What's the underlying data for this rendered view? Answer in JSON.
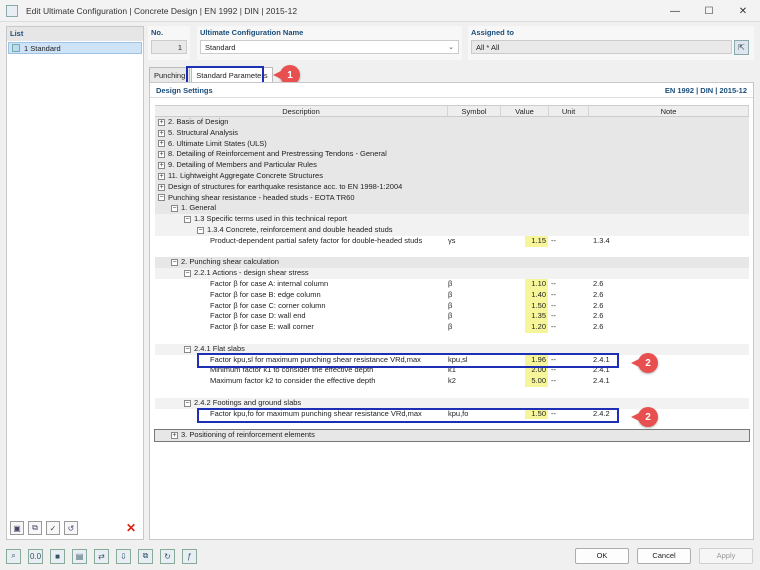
{
  "window": {
    "title": "Edit Ultimate Configuration | Concrete Design | EN 1992 | DIN | 2015-12",
    "min": "—",
    "max": "☐",
    "close": "✕"
  },
  "list": {
    "header": "List",
    "items": [
      {
        "label": "1 Standard"
      }
    ]
  },
  "fields": {
    "no_label": "No.",
    "no_value": "1",
    "name_label": "Ultimate Configuration Name",
    "name_value": "Standard",
    "assigned_label": "Assigned to",
    "assigned_value": "All   *  All"
  },
  "tabs": [
    {
      "label": "Punching",
      "active": false
    },
    {
      "label": "Standard Parameters",
      "active": true
    }
  ],
  "callouts": [
    "1",
    "2",
    "2"
  ],
  "design_settings": {
    "title": "Design Settings",
    "standard": "EN 1992 | DIN | 2015-12"
  },
  "columns": {
    "description": "Description",
    "symbol": "Symbol",
    "value": "Value",
    "unit": "Unit",
    "note": "Note"
  },
  "rows": [
    {
      "id": "r1",
      "desc": "2. Basis of Design",
      "exp": "+"
    },
    {
      "id": "r2",
      "desc": "5. Structural Analysis",
      "exp": "+"
    },
    {
      "id": "r3",
      "desc": "6. Ultimate Limit States (ULS)",
      "exp": "+"
    },
    {
      "id": "r4",
      "desc": "8. Detailing of Reinforcement and Prestressing Tendons - General",
      "exp": "+"
    },
    {
      "id": "r5",
      "desc": "9. Detailing of Members and Particular Rules",
      "exp": "+"
    },
    {
      "id": "r6",
      "desc": "11. Lightweight Aggregate Concrete Structures",
      "exp": "+"
    },
    {
      "id": "r7",
      "desc": "Design of structures for earthquake resistance acc. to EN 1998-1:2004",
      "exp": "+"
    },
    {
      "id": "r8",
      "desc": "Punching shear resistance - headed studs - EOTA TR60",
      "exp": "−"
    },
    {
      "id": "r9",
      "desc": "1. General",
      "exp": "−"
    },
    {
      "id": "r10",
      "desc": "1.3 Specific terms used in this technical report",
      "exp": "−"
    },
    {
      "id": "r11",
      "desc": "1.3.4 Concrete, reinforcement and double headed studs",
      "exp": "−"
    },
    {
      "id": "r12",
      "desc": "Product-dependent partial safety factor for double-headed studs",
      "sym": "γs",
      "val": "1.15",
      "unit": "--",
      "note": "1.3.4"
    },
    {
      "id": "r13",
      "desc": ""
    },
    {
      "id": "r14",
      "desc": "2. Punching shear calculation",
      "exp": "−"
    },
    {
      "id": "r15",
      "desc": "2.2.1 Actions - design shear stress",
      "exp": "−"
    },
    {
      "id": "r16",
      "desc": "Factor β for case A: internal column",
      "sym": "β",
      "val": "1.10",
      "unit": "--",
      "note": "2.6"
    },
    {
      "id": "r17",
      "desc": "Factor β for case B: edge column",
      "sym": "β",
      "val": "1.40",
      "unit": "--",
      "note": "2.6"
    },
    {
      "id": "r18",
      "desc": "Factor β for case C: corner column",
      "sym": "β",
      "val": "1.50",
      "unit": "--",
      "note": "2.6"
    },
    {
      "id": "r19",
      "desc": "Factor β for case D: wall end",
      "sym": "β",
      "val": "1.35",
      "unit": "--",
      "note": "2.6"
    },
    {
      "id": "r20",
      "desc": "Factor β for case E: wall corner",
      "sym": "β",
      "val": "1.20",
      "unit": "--",
      "note": "2.6"
    },
    {
      "id": "r21",
      "desc": ""
    },
    {
      "id": "r22",
      "desc": "2.4.1 Flat slabs",
      "exp": "−"
    },
    {
      "id": "r23",
      "desc": "Factor kpu,sl for maximum punching shear resistance VRd,max",
      "sym": "kpu,sl",
      "val": "1.96",
      "unit": "--",
      "note": "2.4.1"
    },
    {
      "id": "r24",
      "desc": "Minimum factor k1 to consider the effective depth",
      "sym": "k1",
      "val": "2.00",
      "unit": "--",
      "note": "2.4.1"
    },
    {
      "id": "r25",
      "desc": "Maximum factor k2 to consider the effective depth",
      "sym": "k2",
      "val": "5.00",
      "unit": "--",
      "note": "2.4.1"
    },
    {
      "id": "r26",
      "desc": ""
    },
    {
      "id": "r27",
      "desc": "2.4.2 Footings and ground slabs",
      "exp": "−"
    },
    {
      "id": "r28",
      "desc": "Factor kpu,fo for maximum punching shear resistance VRd,max",
      "sym": "kpu,fo",
      "val": "1.50",
      "unit": "--",
      "note": "2.4.2"
    },
    {
      "id": "r29",
      "desc": ""
    },
    {
      "id": "r30",
      "desc": "3. Positioning of reinforcement elements",
      "exp": "+"
    }
  ],
  "buttons": {
    "ok": "OK",
    "cancel": "Cancel",
    "apply": "Apply"
  },
  "colors": {
    "accent": "#1a4d7a",
    "highlight_box": "#1c2fb5",
    "callout": "#e8504f",
    "value_bg": "#f7f59a"
  }
}
